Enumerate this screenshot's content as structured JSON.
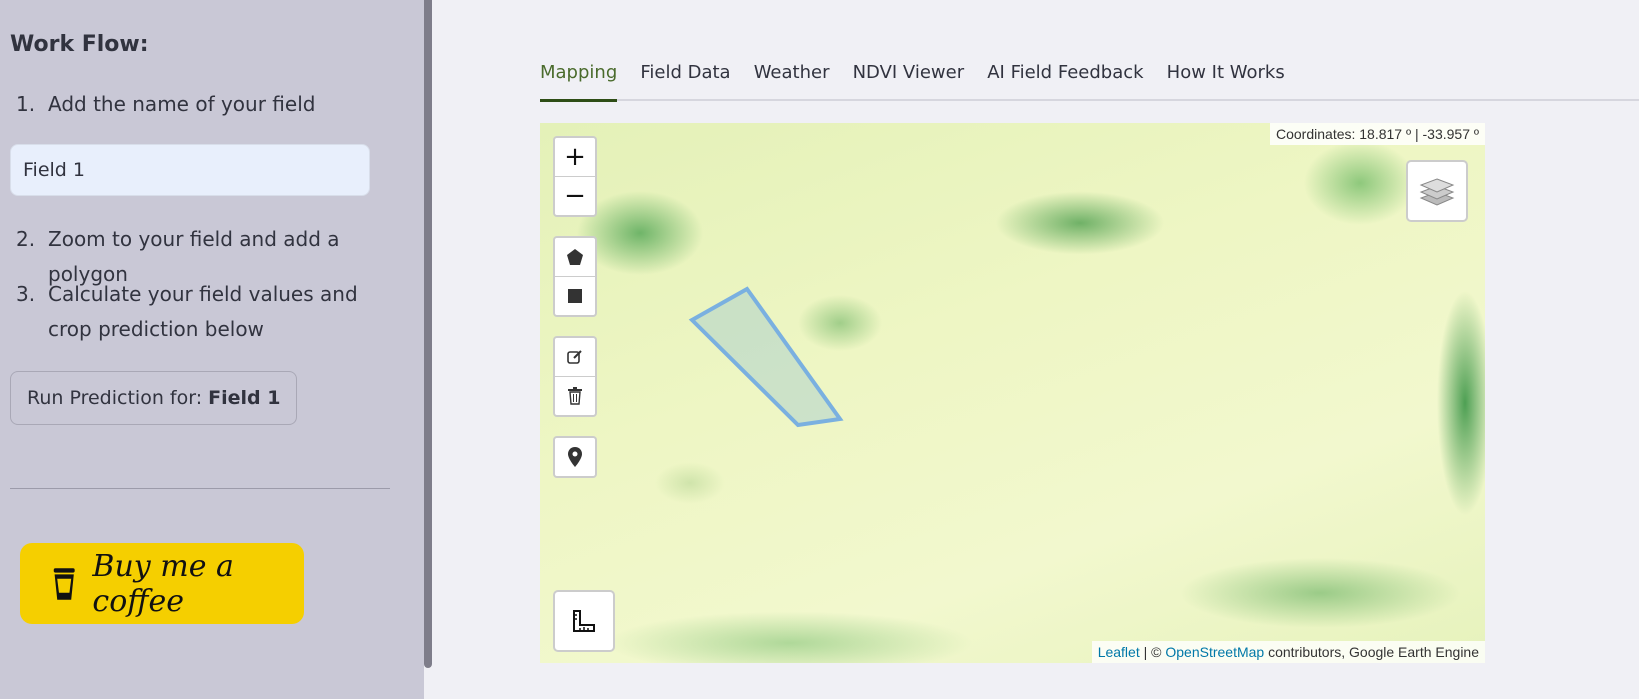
{
  "sidebar": {
    "title": "Work Flow:",
    "steps": [
      {
        "num": "1.",
        "text": "Add the name of your field"
      },
      {
        "num": "2.",
        "text": "Zoom to your field and add a polygon"
      },
      {
        "num": "3.",
        "text": "Calculate your field values and crop prediction below"
      }
    ],
    "field_name_value": "Field 1",
    "run_button_prefix": "Run Prediction for:",
    "run_button_field": "Field 1",
    "coffee_label": "Buy me a coffee"
  },
  "tabs": [
    {
      "label": "Mapping",
      "active": true
    },
    {
      "label": "Field Data",
      "active": false
    },
    {
      "label": "Weather",
      "active": false
    },
    {
      "label": "NDVI Viewer",
      "active": false
    },
    {
      "label": "AI Field Feedback",
      "active": false
    },
    {
      "label": "How It Works",
      "active": false
    }
  ],
  "map": {
    "coordinates": "Coordinates: 18.817 º | -33.957 º",
    "zoom_in": "+",
    "zoom_out": "−",
    "attribution": {
      "leaflet": "Leaflet",
      "separator": "| ©",
      "osm": "OpenStreetMap",
      "rest": "contributors, Google Earth Engine"
    },
    "icons": {
      "polygon": "polygon-icon",
      "rectangle": "rectangle-icon",
      "edit": "edit-icon",
      "delete": "trash-icon",
      "marker": "marker-icon",
      "layers": "layers-icon",
      "measure": "ruler-icon"
    }
  },
  "colors": {
    "sidebar_bg": "#c9c8d6",
    "active_tab": "#4a6b2c",
    "coffee_bg": "#f5cf00",
    "polygon_stroke": "#7ab0e0"
  }
}
